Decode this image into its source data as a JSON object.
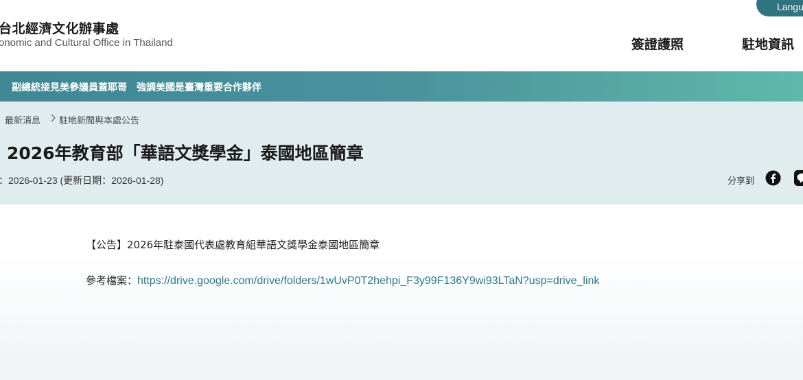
{
  "header": {
    "logo_zh": "台北經濟文化辦事處",
    "logo_en": "onomic and Cultural Office in Thailand",
    "language_button": "Langu",
    "nav": [
      "簽證護照",
      "駐地資訊"
    ]
  },
  "banner": {
    "text": "副總統接見美參議員蓋耶哥　強調美國是臺灣重要合作夥伴"
  },
  "breadcrumb": {
    "items": [
      "最新消息",
      "駐地新聞與本處公告"
    ]
  },
  "article": {
    "title": "】2026年教育部「華語文獎學金」泰國地區簡章",
    "date_line": "：2026-01-23 (更新日期：2026-01-28)",
    "share_label": "分享到",
    "paragraph_1": "【公告】2026年駐泰國代表處教育組華語文獎學金泰國地區簡章",
    "reference_label": "參考檔案：",
    "reference_link": "https://drive.google.com/drive/folders/1wUvP0T2hehpi_F3y99F136Y9wi93LTaN?usp=drive_link"
  },
  "colors": {
    "accent": "#2f7480",
    "banner_start": "#3f8795",
    "banner_end": "#5fb9ab",
    "title_bg": "#e1ecef",
    "link": "#2b7a8a"
  },
  "icons": [
    "chevron-right-icon",
    "facebook-icon",
    "line-icon"
  ]
}
